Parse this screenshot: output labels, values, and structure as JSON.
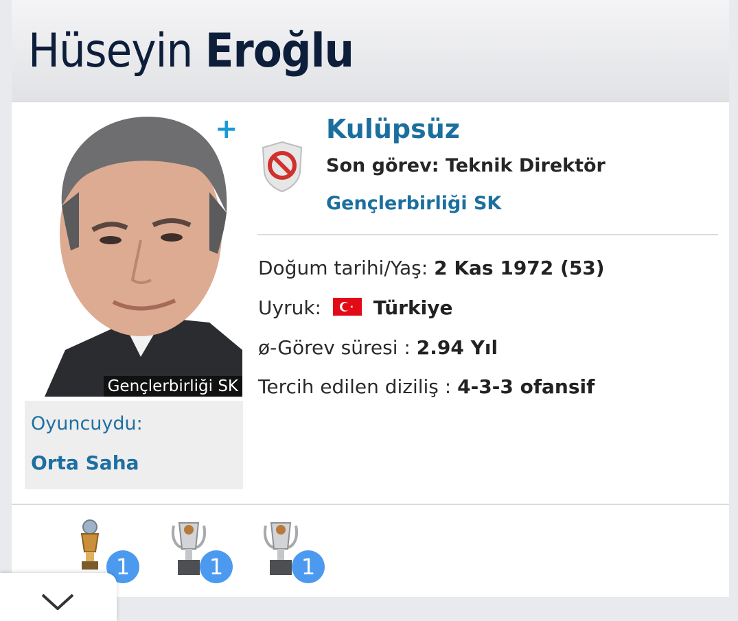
{
  "header": {
    "first_name": "Hüseyin",
    "last_name": "Eroğlu"
  },
  "photo": {
    "caption": "Gençlerbirliği SK"
  },
  "add_icon": "plus-icon",
  "former": {
    "label": "Oyuncuydu:",
    "position": "Orta Saha"
  },
  "club": {
    "icon": "no-club-shield-icon",
    "status": "Kulüpsüz",
    "last_role": "Son görev: Teknik Direktör",
    "last_club": "Gençlerbirliği SK"
  },
  "details": {
    "birth_label": "Doğum tarihi/Yaş:",
    "birth_value": "2 Kas 1972 (53)",
    "nationality_label": "Uyruk:",
    "nationality_value": "Türkiye",
    "tenure_label": "ø-Görev süresi :",
    "tenure_value": "2.94 Yıl",
    "formation_label": "Tercih edilen diziliş :",
    "formation_value": "4-3-3 ofansif"
  },
  "trophies": [
    {
      "icon": "trophy-gold-icon",
      "count": "1"
    },
    {
      "icon": "trophy-silver-icon",
      "count": "1"
    },
    {
      "icon": "trophy-silver-icon",
      "count": "1"
    }
  ],
  "colors": {
    "accent": "#1b6f9e",
    "plus": "#1a9ad6",
    "badge": "#4c9af0",
    "header_text": "#0d1e3a"
  }
}
